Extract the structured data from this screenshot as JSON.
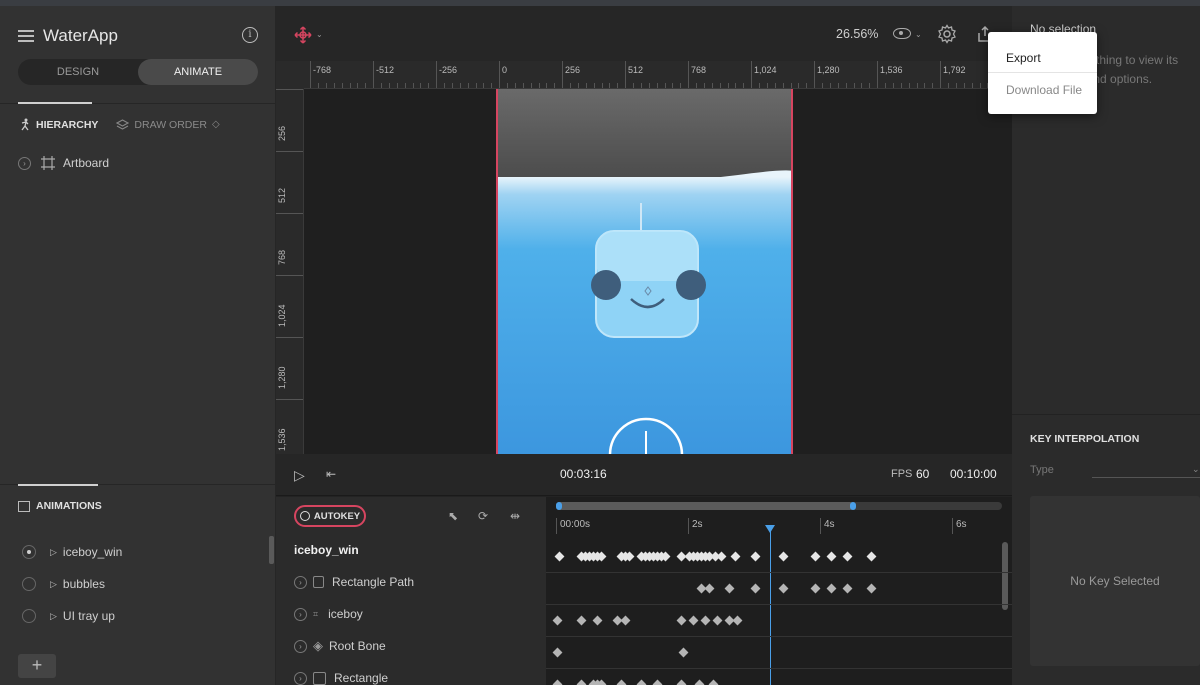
{
  "app": {
    "title": "WaterApp",
    "modes": [
      "DESIGN",
      "ANIMATE"
    ],
    "active_mode": "ANIMATE"
  },
  "hierarchy": {
    "tabs": [
      {
        "label": "HIERARCHY",
        "icon": "running-person-icon",
        "active": true
      },
      {
        "label": "DRAW ORDER",
        "icon": "layers-icon",
        "active": false
      }
    ],
    "items": [
      {
        "label": "Artboard",
        "icon": "artboard-icon"
      }
    ]
  },
  "animations": {
    "header": "ANIMATIONS",
    "items": [
      {
        "label": "iceboy_win",
        "selected": true
      },
      {
        "label": "bubbles",
        "selected": false
      },
      {
        "label": "UI tray up",
        "selected": false
      }
    ],
    "add_label": "+"
  },
  "toolbar": {
    "zoom": "26.56%"
  },
  "ruler": {
    "horizontal": [
      "-768",
      "-512",
      "-256",
      "0",
      "256",
      "512",
      "768",
      "1,024",
      "1,280",
      "1,536",
      "1,792"
    ],
    "vertical": [
      "256",
      "512",
      "768",
      "1,024",
      "1,280",
      "1,536"
    ]
  },
  "timeline": {
    "current_time": "00:03:16",
    "fps_label": "FPS",
    "fps": "60",
    "duration": "00:10:00",
    "autokey_label": "AUTOKEY",
    "time_labels": [
      "00:00s",
      "2s",
      "4s",
      "6s"
    ],
    "rows": [
      {
        "label": "iceboy_win",
        "bold": true
      },
      {
        "label": "Rectangle Path",
        "bold": false
      },
      {
        "label": "iceboy",
        "bold": false
      },
      {
        "label": "Root Bone",
        "bold": false
      },
      {
        "label": "Rectangle",
        "bold": false
      }
    ]
  },
  "inspector": {
    "no_selection": "No selection",
    "hint": "Select something to view its properties and options.",
    "key_interpolation": "KEY INTERPOLATION",
    "type_label": "Type",
    "no_key": "No Key Selected"
  },
  "export_menu": {
    "items": [
      "Export",
      "Download File"
    ]
  },
  "colors": {
    "accent": "#d64560",
    "playhead": "#4a9fe8",
    "water": "#3b95de"
  }
}
